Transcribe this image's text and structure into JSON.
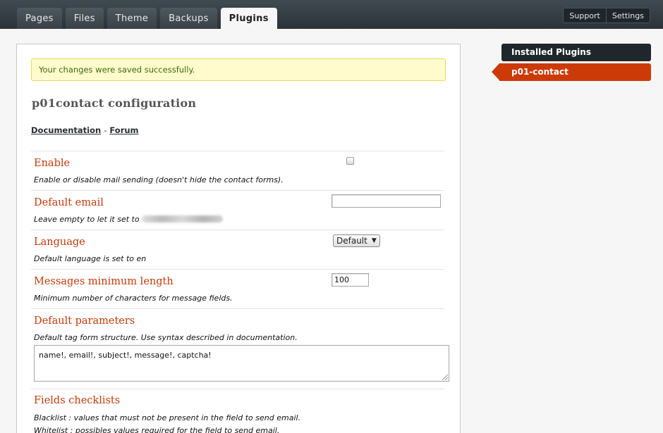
{
  "nav": {
    "tabs": [
      {
        "label": "Pages"
      },
      {
        "label": "Files"
      },
      {
        "label": "Theme"
      },
      {
        "label": "Backups"
      },
      {
        "label": "Plugins"
      }
    ],
    "active_tab": "Plugins",
    "support_label": "Support",
    "settings_label": "Settings"
  },
  "notice": "Your changes were saved successfully.",
  "page_title": "p01contact configuration",
  "links": {
    "documentation": "Documentation",
    "separator": "-",
    "forum": "Forum"
  },
  "settings": {
    "enable": {
      "label": "Enable",
      "desc": "Enable or disable mail sending (doesn't hide the contact forms).",
      "checked": false
    },
    "default_email": {
      "label": "Default email",
      "desc": "Leave empty to let it set to",
      "value": ""
    },
    "language": {
      "label": "Language",
      "desc": "Default language is set to en",
      "selected": "Default"
    },
    "min_length": {
      "label": "Messages minimum length",
      "desc": "Minimum number of characters for message fields.",
      "value": "100"
    },
    "default_params": {
      "label": "Default parameters",
      "desc": "Default tag form structure. Use syntax described in documentation.",
      "value": "name!, email!, subject!, message!, captcha!"
    },
    "checklists": {
      "label": "Fields checklists",
      "desc1": "Blacklist : values that must not be present in the field to send email.",
      "desc2": "Whitelist : possibles values required for the field to send email."
    }
  },
  "sidebar": {
    "header": "Installed Plugins",
    "items": [
      {
        "label": "p01-contact"
      }
    ]
  },
  "colors": {
    "accent": "#cc3a08",
    "label": "#c33a08",
    "notice_bg": "#fffbcc",
    "topbar": "#2b3339"
  }
}
